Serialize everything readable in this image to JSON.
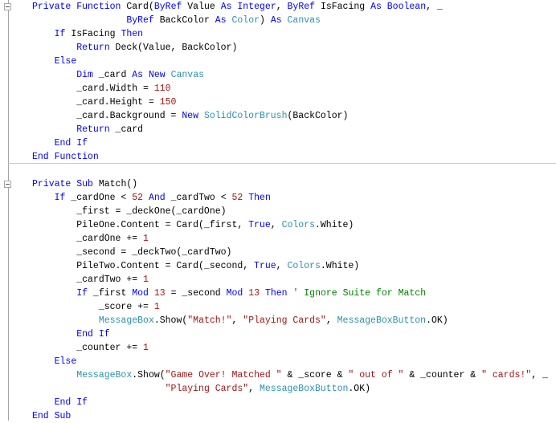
{
  "colors": {
    "keyword": "#0000ff",
    "type": "#2b91af",
    "number": "#a31515",
    "string": "#a31515",
    "comment": "#008000",
    "text": "#000000"
  },
  "gutter": {
    "collapse_icons": [
      "collapse-function-card",
      "collapse-sub-match"
    ]
  },
  "lines": [
    [
      [
        "k",
        "Private"
      ],
      [
        "p",
        " "
      ],
      [
        "k",
        "Function"
      ],
      [
        "p",
        " Card("
      ],
      [
        "k",
        "ByRef"
      ],
      [
        "p",
        " Value "
      ],
      [
        "k",
        "As"
      ],
      [
        "p",
        " "
      ],
      [
        "k",
        "Integer"
      ],
      [
        "p",
        ", "
      ],
      [
        "k",
        "ByRef"
      ],
      [
        "p",
        " IsFacing "
      ],
      [
        "k",
        "As"
      ],
      [
        "p",
        " "
      ],
      [
        "k",
        "Boolean"
      ],
      [
        "p",
        ", _"
      ]
    ],
    [
      [
        "p",
        "                 "
      ],
      [
        "k",
        "ByRef"
      ],
      [
        "p",
        " BackColor "
      ],
      [
        "k",
        "As"
      ],
      [
        "p",
        " "
      ],
      [
        "t",
        "Color"
      ],
      [
        "p",
        ") "
      ],
      [
        "k",
        "As"
      ],
      [
        "p",
        " "
      ],
      [
        "t",
        "Canvas"
      ]
    ],
    [
      [
        "p",
        "    "
      ],
      [
        "k",
        "If"
      ],
      [
        "p",
        " IsFacing "
      ],
      [
        "k",
        "Then"
      ]
    ],
    [
      [
        "p",
        "        "
      ],
      [
        "k",
        "Return"
      ],
      [
        "p",
        " Deck(Value, BackColor)"
      ]
    ],
    [
      [
        "p",
        "    "
      ],
      [
        "k",
        "Else"
      ]
    ],
    [
      [
        "p",
        "        "
      ],
      [
        "k",
        "Dim"
      ],
      [
        "p",
        " _card "
      ],
      [
        "k",
        "As"
      ],
      [
        "p",
        " "
      ],
      [
        "k",
        "New"
      ],
      [
        "p",
        " "
      ],
      [
        "t",
        "Canvas"
      ]
    ],
    [
      [
        "p",
        "        _card.Width = "
      ],
      [
        "n",
        "110"
      ]
    ],
    [
      [
        "p",
        "        _card.Height = "
      ],
      [
        "n",
        "150"
      ]
    ],
    [
      [
        "p",
        "        _card.Background = "
      ],
      [
        "k",
        "New"
      ],
      [
        "p",
        " "
      ],
      [
        "t",
        "SolidColorBrush"
      ],
      [
        "p",
        "(BackColor)"
      ]
    ],
    [
      [
        "p",
        "        "
      ],
      [
        "k",
        "Return"
      ],
      [
        "p",
        " _card"
      ]
    ],
    [
      [
        "p",
        "    "
      ],
      [
        "k",
        "End"
      ],
      [
        "p",
        " "
      ],
      [
        "k",
        "If"
      ]
    ],
    [
      [
        "k",
        "End"
      ],
      [
        "p",
        " "
      ],
      [
        "k",
        "Function"
      ]
    ],
    [],
    [
      [
        "k",
        "Private"
      ],
      [
        "p",
        " "
      ],
      [
        "k",
        "Sub"
      ],
      [
        "p",
        " Match()"
      ]
    ],
    [
      [
        "p",
        "    "
      ],
      [
        "k",
        "If"
      ],
      [
        "p",
        " _cardOne < "
      ],
      [
        "n",
        "52"
      ],
      [
        "p",
        " "
      ],
      [
        "k",
        "And"
      ],
      [
        "p",
        " _cardTwo < "
      ],
      [
        "n",
        "52"
      ],
      [
        "p",
        " "
      ],
      [
        "k",
        "Then"
      ]
    ],
    [
      [
        "p",
        "        _first = _deckOne(_cardOne)"
      ]
    ],
    [
      [
        "p",
        "        PileOne.Content = Card(_first, "
      ],
      [
        "k",
        "True"
      ],
      [
        "p",
        ", "
      ],
      [
        "t",
        "Colors"
      ],
      [
        "p",
        ".White)"
      ]
    ],
    [
      [
        "p",
        "        _cardOne += "
      ],
      [
        "n",
        "1"
      ]
    ],
    [
      [
        "p",
        "        _second = _deckTwo(_cardTwo)"
      ]
    ],
    [
      [
        "p",
        "        PileTwo.Content = Card(_second, "
      ],
      [
        "k",
        "True"
      ],
      [
        "p",
        ", "
      ],
      [
        "t",
        "Colors"
      ],
      [
        "p",
        ".White)"
      ]
    ],
    [
      [
        "p",
        "        _cardTwo += "
      ],
      [
        "n",
        "1"
      ]
    ],
    [
      [
        "p",
        "        "
      ],
      [
        "k",
        "If"
      ],
      [
        "p",
        " _first "
      ],
      [
        "k",
        "Mod"
      ],
      [
        "p",
        " "
      ],
      [
        "n",
        "13"
      ],
      [
        "p",
        " = _second "
      ],
      [
        "k",
        "Mod"
      ],
      [
        "p",
        " "
      ],
      [
        "n",
        "13"
      ],
      [
        "p",
        " "
      ],
      [
        "k",
        "Then"
      ],
      [
        "p",
        " "
      ],
      [
        "c",
        "' Ignore Suite for Match"
      ]
    ],
    [
      [
        "p",
        "            _score += "
      ],
      [
        "n",
        "1"
      ]
    ],
    [
      [
        "p",
        "            "
      ],
      [
        "t",
        "MessageBox"
      ],
      [
        "p",
        ".Show("
      ],
      [
        "s",
        "\"Match!\""
      ],
      [
        "p",
        ", "
      ],
      [
        "s",
        "\"Playing Cards\""
      ],
      [
        "p",
        ", "
      ],
      [
        "t",
        "MessageBoxButton"
      ],
      [
        "p",
        ".OK)"
      ]
    ],
    [
      [
        "p",
        "        "
      ],
      [
        "k",
        "End"
      ],
      [
        "p",
        " "
      ],
      [
        "k",
        "If"
      ]
    ],
    [
      [
        "p",
        "        _counter += "
      ],
      [
        "n",
        "1"
      ]
    ],
    [
      [
        "p",
        "    "
      ],
      [
        "k",
        "Else"
      ]
    ],
    [
      [
        "p",
        "        "
      ],
      [
        "t",
        "MessageBox"
      ],
      [
        "p",
        ".Show("
      ],
      [
        "s",
        "\"Game Over! Matched \""
      ],
      [
        "p",
        " & _score & "
      ],
      [
        "s",
        "\" out of \""
      ],
      [
        "p",
        " & _counter & "
      ],
      [
        "s",
        "\" cards!\""
      ],
      [
        "p",
        ", _"
      ]
    ],
    [
      [
        "p",
        "                        "
      ],
      [
        "s",
        "\"Playing Cards\""
      ],
      [
        "p",
        ", "
      ],
      [
        "t",
        "MessageBoxButton"
      ],
      [
        "p",
        ".OK)"
      ]
    ],
    [
      [
        "p",
        "    "
      ],
      [
        "k",
        "End"
      ],
      [
        "p",
        " "
      ],
      [
        "k",
        "If"
      ]
    ],
    [
      [
        "k",
        "End"
      ],
      [
        "p",
        " "
      ],
      [
        "k",
        "Sub"
      ]
    ]
  ]
}
